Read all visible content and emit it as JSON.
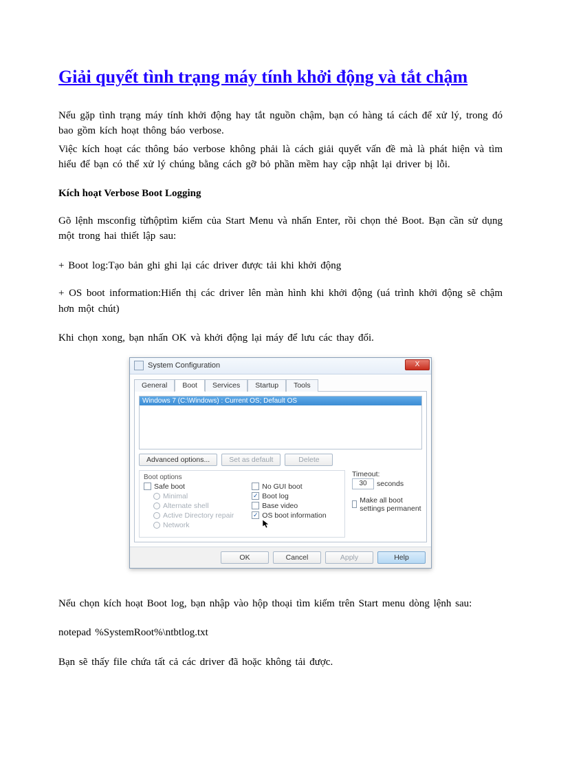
{
  "title": "Giải quyết tình trạng máy tính khởi động và tắt chậm",
  "p1": "Nếu gặp tình trạng máy tính khởi động hay tắt nguồn chậm, bạn có hàng tá cách để xử lý, trong đó bao gồm kích hoạt thông báo verbose.",
  "p2": "Việc kích hoạt các thông báo verbose không phải là cách giải quyết vấn đề mà là phát hiện và tìm hiểu để bạn có thể xử lý chúng bằng cách gỡ bỏ phần mềm hay cập nhật lại driver bị lỗi.",
  "section_heading": "Kích hoạt Verbose Boot Logging",
  "p3": "Gõ lệnh msconfig  từhộptìm kiếm của Start Menu và nhấn Enter, rồi chọn thẻ Boot. Bạn cần sử dụng một trong hai thiết lập sau:",
  "p4": "+ Boot log:Tạo  bản ghi ghi  lại các driver  được tải khi khởi động",
  "p5": "+ OS boot information:Hiển    thị các driver  lên màn hình  khi khởi động (uá trình khởi động sẽ chậm hơn một chút)",
  "p6": "Khi chọn xong, bạn nhấn OK và khởi động lại máy để lưu các thay đổi.",
  "p7": "Nếu chọn kích hoạt Boot log, bạn nhập vào hộp thoại tìm kiếm trên Start menu dòng lệnh sau:",
  "p8": "notepad %SystemRoot%\\ntbtlog.txt",
  "p9": "Bạn sẽ thấy file  chứa tất cả các driver  đã hoặc không tải được.",
  "dialog": {
    "title": "System Configuration",
    "close": "X",
    "tabs": {
      "general": "General",
      "boot": "Boot",
      "services": "Services",
      "startup": "Startup",
      "tools": "Tools"
    },
    "list_item": "Windows 7 (C:\\Windows) : Current OS; Default OS",
    "buttons": {
      "advanced": "Advanced options...",
      "setdefault": "Set as default",
      "delete": "Delete",
      "ok": "OK",
      "cancel": "Cancel",
      "apply": "Apply",
      "help": "Help"
    },
    "bootoptions": {
      "legend": "Boot options",
      "safeboot": "Safe boot",
      "minimal": "Minimal",
      "altshell": "Alternate shell",
      "adrepair": "Active Directory repair",
      "network": "Network",
      "nogui": "No GUI boot",
      "bootlog": "Boot log",
      "basevideo": "Base video",
      "osbootinfo": "OS boot information"
    },
    "timeout": {
      "label": "Timeout:",
      "value": "30",
      "unit": "seconds"
    },
    "permanent": "Make all boot settings permanent"
  }
}
